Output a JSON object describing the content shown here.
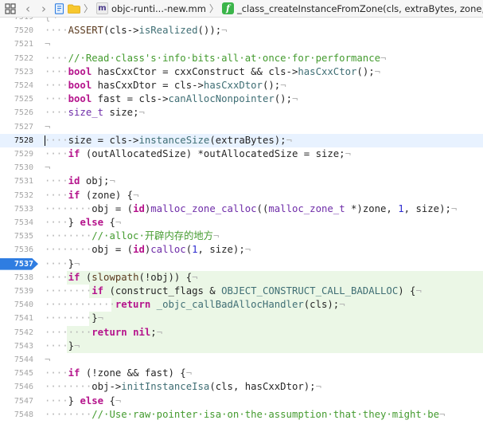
{
  "jumpbar": {
    "project_label": "",
    "file_name": "objc-runti...-new.mm",
    "file_icon_letter": "m",
    "function_name": "_class_createInstanceFromZone(cls, extraBytes, zone, OB...",
    "function_icon_letter": "f"
  },
  "editor": {
    "current_line": 7528,
    "breakpoint_line": 7537,
    "lines": [
      {
        "n": 7519,
        "tokens": [
          [
            "inv",
            "{¬"
          ]
        ]
      },
      {
        "n": 7520,
        "tokens": [
          [
            "inv",
            "····"
          ],
          [
            "macro",
            "ASSERT"
          ],
          [
            "plain",
            "(cls->"
          ],
          [
            "func",
            "isRealized"
          ],
          [
            "plain",
            "());"
          ],
          [
            "inv",
            "¬"
          ]
        ]
      },
      {
        "n": 7521,
        "tokens": [
          [
            "inv",
            "¬"
          ]
        ]
      },
      {
        "n": 7522,
        "tokens": [
          [
            "inv",
            "····"
          ],
          [
            "cmt",
            "//·Read·class's·info·bits·all·at·once·for·performance"
          ],
          [
            "inv",
            "¬"
          ]
        ]
      },
      {
        "n": 7523,
        "tokens": [
          [
            "inv",
            "····"
          ],
          [
            "kw",
            "bool"
          ],
          [
            "plain",
            " hasCxxCtor = cxxConstruct && cls->"
          ],
          [
            "func",
            "hasCxxCtor"
          ],
          [
            "plain",
            "();"
          ],
          [
            "inv",
            "¬"
          ]
        ]
      },
      {
        "n": 7524,
        "tokens": [
          [
            "inv",
            "····"
          ],
          [
            "kw",
            "bool"
          ],
          [
            "plain",
            " hasCxxDtor = cls->"
          ],
          [
            "func",
            "hasCxxDtor"
          ],
          [
            "plain",
            "();"
          ],
          [
            "inv",
            "¬"
          ]
        ]
      },
      {
        "n": 7525,
        "tokens": [
          [
            "inv",
            "····"
          ],
          [
            "kw",
            "bool"
          ],
          [
            "plain",
            " fast = cls->"
          ],
          [
            "func",
            "canAllocNonpointer"
          ],
          [
            "plain",
            "();"
          ],
          [
            "inv",
            "¬"
          ]
        ]
      },
      {
        "n": 7526,
        "tokens": [
          [
            "inv",
            "····"
          ],
          [
            "type",
            "size_t"
          ],
          [
            "plain",
            " size;"
          ],
          [
            "inv",
            "¬"
          ]
        ]
      },
      {
        "n": 7527,
        "tokens": [
          [
            "inv",
            "¬"
          ]
        ]
      },
      {
        "n": 7528,
        "tokens": [
          [
            "inv",
            "····"
          ],
          [
            "plain",
            "size = cls->"
          ],
          [
            "func",
            "instanceSize"
          ],
          [
            "plain",
            "(extraBytes);"
          ],
          [
            "inv",
            "¬"
          ]
        ]
      },
      {
        "n": 7529,
        "tokens": [
          [
            "inv",
            "····"
          ],
          [
            "kw",
            "if"
          ],
          [
            "plain",
            " (outAllocatedSize) *outAllocatedSize = size;"
          ],
          [
            "inv",
            "¬"
          ]
        ]
      },
      {
        "n": 7530,
        "tokens": [
          [
            "inv",
            "¬"
          ]
        ]
      },
      {
        "n": 7531,
        "tokens": [
          [
            "inv",
            "····"
          ],
          [
            "kw",
            "id"
          ],
          [
            "plain",
            " obj;"
          ],
          [
            "inv",
            "¬"
          ]
        ]
      },
      {
        "n": 7532,
        "tokens": [
          [
            "inv",
            "····"
          ],
          [
            "kw",
            "if"
          ],
          [
            "plain",
            " (zone) {"
          ],
          [
            "inv",
            "¬"
          ]
        ]
      },
      {
        "n": 7533,
        "tokens": [
          [
            "inv",
            "········"
          ],
          [
            "plain",
            "obj = ("
          ],
          [
            "kw",
            "id"
          ],
          [
            "plain",
            ")"
          ],
          [
            "type",
            "malloc_zone_calloc"
          ],
          [
            "plain",
            "(("
          ],
          [
            "type",
            "malloc_zone_t"
          ],
          [
            "plain",
            " *)zone, "
          ],
          [
            "num",
            "1"
          ],
          [
            "plain",
            ", size);"
          ],
          [
            "inv",
            "¬"
          ]
        ]
      },
      {
        "n": 7534,
        "tokens": [
          [
            "inv",
            "····"
          ],
          [
            "plain",
            "} "
          ],
          [
            "kw",
            "else"
          ],
          [
            "plain",
            " {"
          ],
          [
            "inv",
            "¬"
          ]
        ]
      },
      {
        "n": 7535,
        "tokens": [
          [
            "inv",
            "········"
          ],
          [
            "cmt",
            "//·alloc·"
          ],
          [
            "cmtcn",
            "开辟内存的地方"
          ],
          [
            "inv",
            "¬"
          ]
        ]
      },
      {
        "n": 7536,
        "tokens": [
          [
            "inv",
            "········"
          ],
          [
            "plain",
            "obj = ("
          ],
          [
            "kw",
            "id"
          ],
          [
            "plain",
            ")"
          ],
          [
            "type",
            "calloc"
          ],
          [
            "plain",
            "("
          ],
          [
            "num",
            "1"
          ],
          [
            "plain",
            ", size);"
          ],
          [
            "inv",
            "¬"
          ]
        ]
      },
      {
        "n": 7537,
        "tokens": [
          [
            "inv",
            "····"
          ],
          [
            "plain",
            "}"
          ],
          [
            "inv",
            "¬"
          ]
        ]
      },
      {
        "n": 7538,
        "tokens": [
          [
            "inv",
            "····"
          ],
          [
            "kw",
            "if"
          ],
          [
            "plain",
            " ("
          ],
          [
            "macro",
            "slowpath"
          ],
          [
            "plain",
            "(!obj)) {"
          ],
          [
            "inv",
            "¬"
          ]
        ]
      },
      {
        "n": 7539,
        "tokens": [
          [
            "inv",
            "········"
          ],
          [
            "kw",
            "if"
          ],
          [
            "plain",
            " (construct_flags & "
          ],
          [
            "func",
            "OBJECT_CONSTRUCT_CALL_BADALLOC"
          ],
          [
            "plain",
            ") {"
          ],
          [
            "inv",
            "¬"
          ]
        ]
      },
      {
        "n": 7540,
        "tokens": [
          [
            "inv",
            "············"
          ],
          [
            "kw",
            "return"
          ],
          [
            "plain",
            " "
          ],
          [
            "func",
            "_objc_callBadAllocHandler"
          ],
          [
            "plain",
            "(cls);"
          ],
          [
            "inv",
            "¬"
          ]
        ]
      },
      {
        "n": 7541,
        "tokens": [
          [
            "inv",
            "········"
          ],
          [
            "plain",
            "}"
          ],
          [
            "inv",
            "¬"
          ]
        ]
      },
      {
        "n": 7542,
        "tokens": [
          [
            "inv",
            "········"
          ],
          [
            "kw",
            "return"
          ],
          [
            "plain",
            " "
          ],
          [
            "kw",
            "nil"
          ],
          [
            "plain",
            ";"
          ],
          [
            "inv",
            "¬"
          ]
        ]
      },
      {
        "n": 7543,
        "tokens": [
          [
            "inv",
            "····"
          ],
          [
            "plain",
            "}"
          ],
          [
            "inv",
            "¬"
          ]
        ]
      },
      {
        "n": 7544,
        "tokens": [
          [
            "inv",
            "¬"
          ]
        ]
      },
      {
        "n": 7545,
        "tokens": [
          [
            "inv",
            "····"
          ],
          [
            "kw",
            "if"
          ],
          [
            "plain",
            " (!zone && fast) {"
          ],
          [
            "inv",
            "¬"
          ]
        ]
      },
      {
        "n": 7546,
        "tokens": [
          [
            "inv",
            "········"
          ],
          [
            "plain",
            "obj->"
          ],
          [
            "func",
            "initInstanceIsa"
          ],
          [
            "plain",
            "(cls, hasCxxDtor);"
          ],
          [
            "inv",
            "¬"
          ]
        ]
      },
      {
        "n": 7547,
        "tokens": [
          [
            "inv",
            "····"
          ],
          [
            "plain",
            "} "
          ],
          [
            "kw",
            "else"
          ],
          [
            "plain",
            " {"
          ],
          [
            "inv",
            "¬"
          ]
        ]
      },
      {
        "n": 7548,
        "tokens": [
          [
            "inv",
            "········"
          ],
          [
            "cmt",
            "//·Use·raw·pointer·isa·on·the·assumption·that·they·might·be"
          ],
          [
            "inv",
            "¬"
          ]
        ]
      }
    ]
  }
}
